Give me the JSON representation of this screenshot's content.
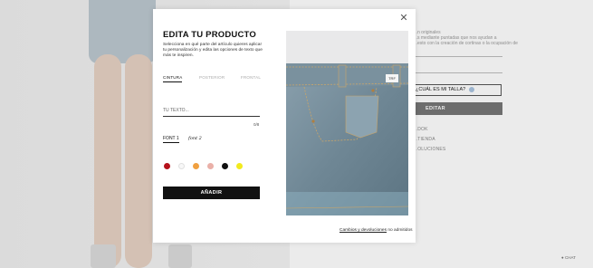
{
  "background_page": {
    "info_text_lines": [
      "…n originales",
      "…s mediante puntadas que nos ayudan a",
      "…esto con la creación de cortinas o la ocupación de"
    ],
    "size_question": "¿CUÁL ES MI TALLA?",
    "edit_button": "EDITAR",
    "links": [
      "…DOK",
      "…TIENDA",
      "…OLUCIONES"
    ],
    "chat_label": "CHAT"
  },
  "modal": {
    "title": "EDITA TU PRODUCTO",
    "description": "Selecciona en qué parte del artículo quieres aplicar tu personalización y edita las opciones de texto que más te inspiren.",
    "tabs": [
      {
        "label": "CINTURA",
        "active": true
      },
      {
        "label": "POSTERIOR",
        "active": false
      },
      {
        "label": "FRONTAL",
        "active": false
      }
    ],
    "text_input": {
      "placeholder": "TU TEXTO...",
      "value": ""
    },
    "counter": "0/8",
    "fonts": [
      {
        "label": "FONT 1",
        "active": true
      },
      {
        "label": "font 2",
        "active": false
      }
    ],
    "colors": [
      {
        "name": "red",
        "hex": "#b5121b"
      },
      {
        "name": "white",
        "hex": "#f8f8f8"
      },
      {
        "name": "orange",
        "hex": "#f0a040"
      },
      {
        "name": "pink",
        "hex": "#eab0a8"
      },
      {
        "name": "black",
        "hex": "#111111"
      },
      {
        "name": "yellow",
        "hex": "#f2ea1e"
      }
    ],
    "add_button": "AÑADIR",
    "footer_link": "Cambios y devoluciones",
    "footer_suffix": " no admitidos",
    "product_label": "TRF"
  }
}
